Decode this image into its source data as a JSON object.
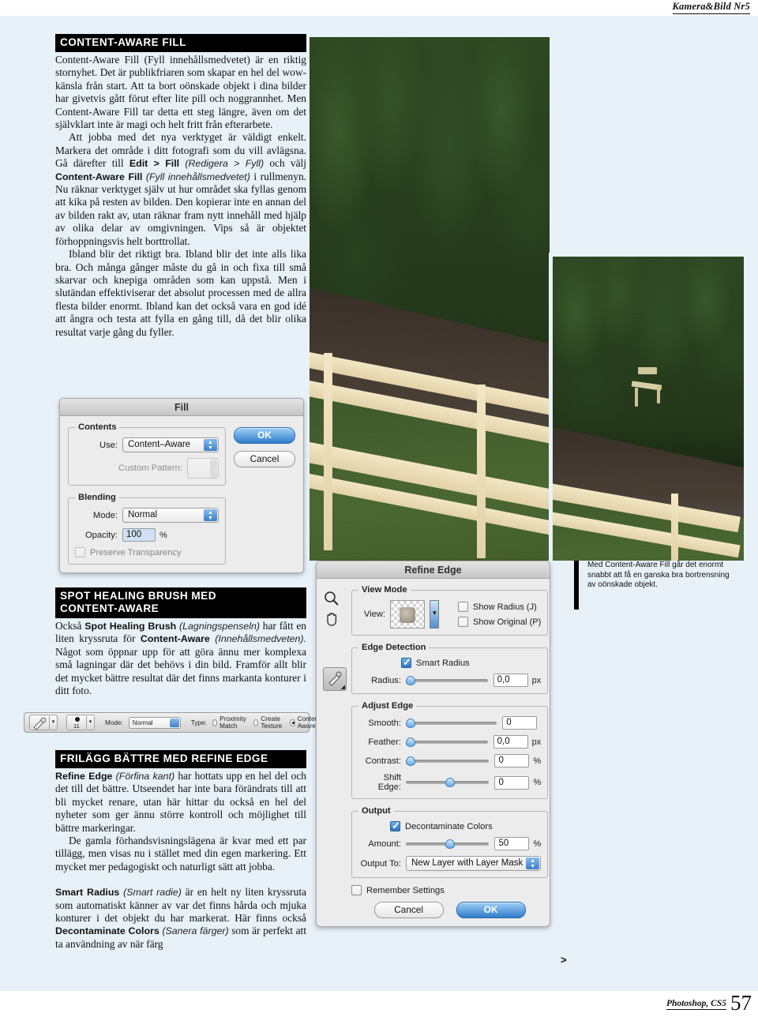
{
  "page": {
    "header": "Kamera&Bild Nr5",
    "footer_text": "Photoshop, CS5",
    "footer_number": "57",
    "bg_color": "#e8f1f8",
    "accent_color": "#000000"
  },
  "sections": [
    {
      "heading": "CONTENT-AWARE FILL",
      "paragraphs": [
        "Content-Aware Fill (Fyll innehållsmedvetet) är en riktig stornyhet. Det är publikfriaren som skapar en hel del wow-känsla från start. Att ta bort oönskade objekt i dina bilder har givetvis gått förut efter lite pill och noggrannhet. Men Content-Aware Fill tar detta ett steg längre, även om det självklart inte är magi och helt fritt från efterarbete.",
        "Att jobba med det nya verktyget är väldigt enkelt. Markera det område i ditt fotografi som du vill avlägsna. Gå därefter till Edit > Fill (Redigera > Fyll) och välj Content-Aware Fill (Fyll innehållsmedvetet) i rullmenyn. Nu räknar verktyget själv ut hur området ska fyllas genom att kika på resten av bilden. Den kopierar inte en annan del av bilden rakt av, utan räknar fram nytt innehåll med hjälp av olika delar av omgivningen. Vips så är objektet förhoppningsvis helt borttrollat.",
        "Ibland blir det riktigt bra. Ibland blir det inte alls lika bra. Och många gånger måste du gå in och fixa till små skarvar och knepiga områden som kan uppstå. Men i slutändan effektiviserar det absolut processen med de allra flesta bilder enormt. Ibland kan det också vara en god idé att ångra och testa att fylla en gång till, då det blir olika resultat varje gång du fyller."
      ]
    },
    {
      "heading_line1": "SPOT HEALING BRUSH MED",
      "heading_line2": "CONTENT-AWARE",
      "paragraph": "Också Spot Healing Brush (Lagningspenseln) har fått en liten kryssruta för Content-Aware (Innehållsmedveten). Något som öppnar upp för att göra ännu mer komplexa små lagningar där det behövs i din bild. Framför allt blir det mycket bättre resultat där det finns markanta konturer i ditt foto."
    },
    {
      "heading": "FRILÄGG BÄTTRE MED REFINE EDGE",
      "paragraphs": [
        "Refine Edge (Förfina kant) har hottats upp en hel del och det till det bättre. Utseendet har inte bara förändrats till att bli mycket renare, utan här hittar du också en hel del nyheter som ger ännu större kontroll och möjlighet till bättre markeringar.",
        "De gamla förhandsvisningslägena är kvar med ett par tillägg, men visas nu i stället med din egen markering. Ett mycket mer pedagogiskt och naturligt sätt att jobba.",
        "Smart Radius (Smart radie) är en helt ny liten kryssruta som automatiskt känner av var det finns hårda och mjuka konturer i det objekt du har markerat. Här finns också Decontaminate Colors (Sanera färger) som är perfekt att ta användning av när färg"
      ]
    }
  ],
  "inline_terms": {
    "edit_fill_bold": "Edit > Fill",
    "edit_fill_it": "(Redigera > Fyll)",
    "caf_bold": "Content-Aware Fill",
    "caf_it": "(Fyll innehållsmedvetet)",
    "shb_bold": "Spot Healing Brush",
    "shb_it": "(Lagningspenseln)",
    "ca_bold": "Content-Aware",
    "ca_it": "(Innehållsmedveten).",
    "re_bold": "Refine Edge",
    "re_it": "(Förfina kant)",
    "sr_bold": "Smart Radius",
    "sr_it": "(Smart radie)",
    "dc_bold": "Decontaminate Colors",
    "dc_it": "(Sanera färger)"
  },
  "fill_dialog": {
    "title": "Fill",
    "contents_group": "Contents",
    "use_label": "Use:",
    "use_value": "Content–Aware",
    "custom_pattern_label": "Custom Pattern:",
    "blending_group": "Blending",
    "mode_label": "Mode:",
    "mode_value": "Normal",
    "opacity_label": "Opacity:",
    "opacity_value": "100",
    "opacity_unit": "%",
    "preserve_transparency": "Preserve Transparency",
    "ok": "OK",
    "cancel": "Cancel"
  },
  "option_bar": {
    "brush_size": "11",
    "mode_label": "Mode:",
    "mode_value": "Normal",
    "type_label": "Type:",
    "type_options": [
      "Proximity Match",
      "Create Texture",
      "Content-Aware"
    ],
    "type_selected": "Content-Aware"
  },
  "refine_edge_dialog": {
    "title": "Refine Edge",
    "view_mode_group": "View Mode",
    "view_label": "View:",
    "show_radius": "Show Radius (J)",
    "show_original": "Show Original (P)",
    "edge_detection_group": "Edge Detection",
    "smart_radius": "Smart Radius",
    "radius_label": "Radius:",
    "radius_value": "0,0",
    "radius_unit": "px",
    "adjust_edge_group": "Adjust Edge",
    "smooth_label": "Smooth:",
    "smooth_value": "0",
    "feather_label": "Feather:",
    "feather_value": "0,0",
    "feather_unit": "px",
    "contrast_label": "Contrast:",
    "contrast_value": "0",
    "contrast_unit": "%",
    "shift_edge_label": "Shift Edge:",
    "shift_edge_value": "0",
    "shift_edge_unit": "%",
    "output_group": "Output",
    "decontaminate_colors": "Decontaminate Colors",
    "amount_label": "Amount:",
    "amount_value": "50",
    "amount_unit": "%",
    "output_to_label": "Output To:",
    "output_to_value": "New Layer with Layer Mask",
    "remember_settings": "Remember Settings",
    "cancel": "Cancel",
    "ok": "OK",
    "zoom_icon": "magnifier-icon",
    "hand_icon": "hand-icon",
    "brush_icon": "refine-brush-icon"
  },
  "caption": {
    "text": "Med Content-Aware Fill går det enormt snabbt att få en ganska bra bortrensning av oönskade objekt."
  },
  "pointer": {
    "glyph": ">"
  }
}
